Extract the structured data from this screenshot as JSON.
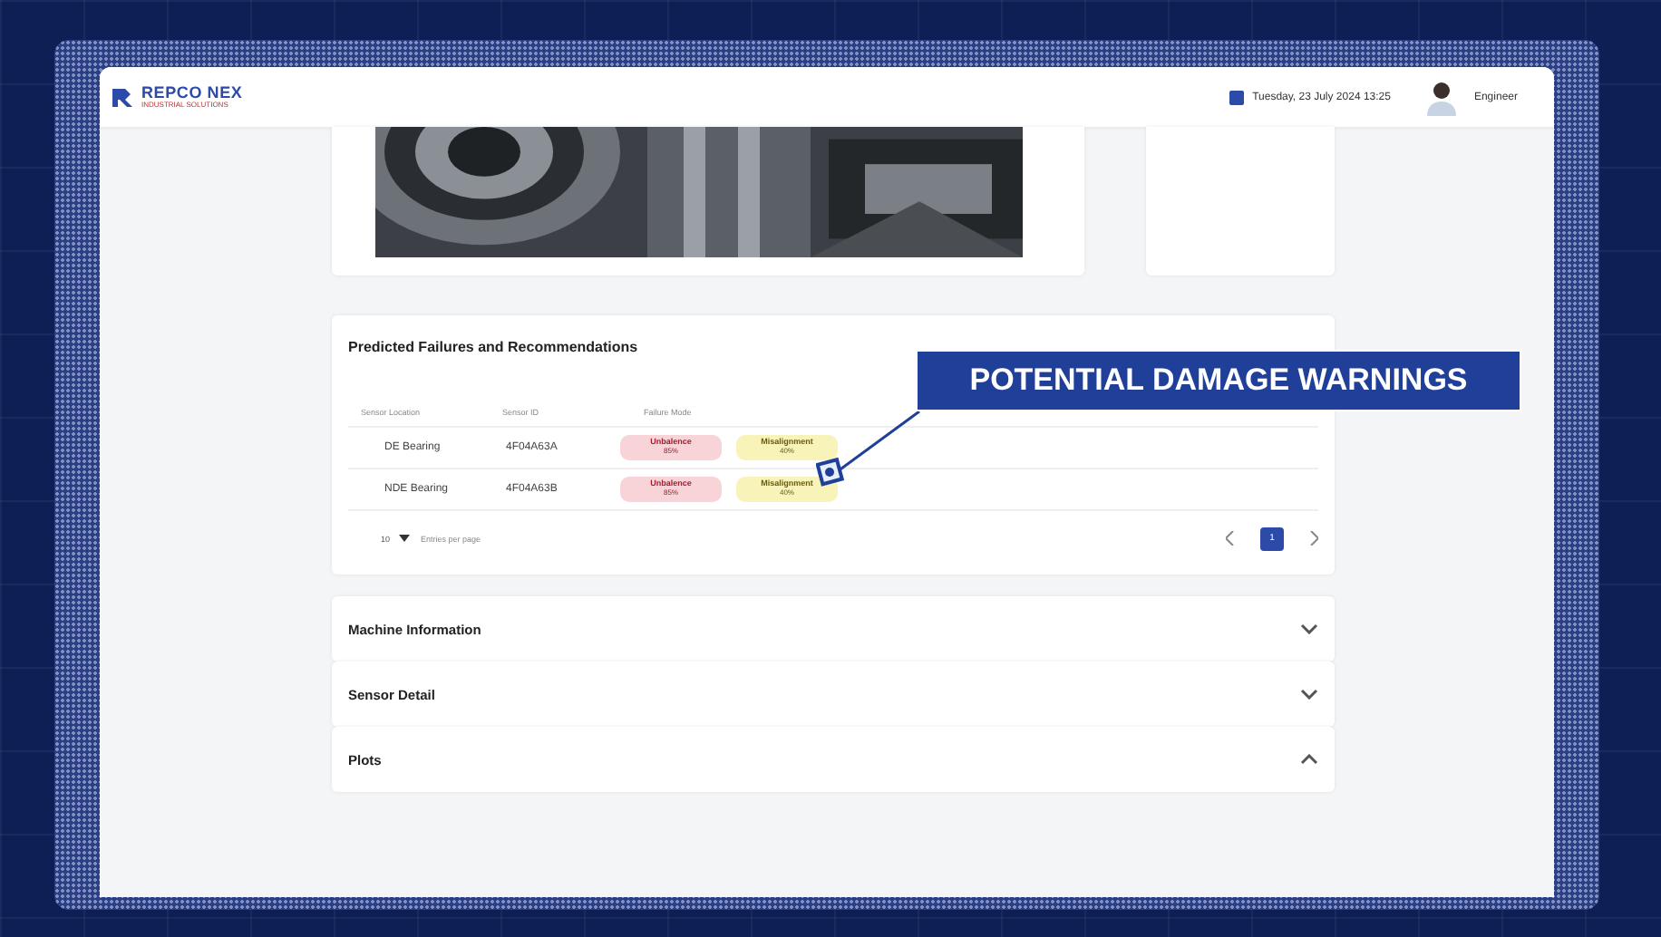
{
  "header": {
    "logo": "REPCO NEX",
    "logo_subtitle": "INDUSTRIAL SOLUTIONS",
    "datetime": "Tuesday, 23 July 2024 13:25",
    "user": "Engineer"
  },
  "failures": {
    "title": "Predicted Failures and Recommendations",
    "columns": [
      "Sensor Location",
      "Sensor ID",
      "Failure Mode"
    ],
    "rows": [
      {
        "location": "DE Bearing",
        "sensor_id": "4F04A63A",
        "modes": [
          {
            "name": "Unbalence",
            "percent": "85%",
            "kind": "severe"
          },
          {
            "name": "Misalignment",
            "percent": "40%",
            "kind": "moderate"
          }
        ]
      },
      {
        "location": "NDE Bearing",
        "sensor_id": "4F04A63B",
        "modes": [
          {
            "name": "Unbalence",
            "percent": "85%",
            "kind": "severe"
          },
          {
            "name": "Misalignment",
            "percent": "40%",
            "kind": "moderate"
          }
        ]
      }
    ],
    "page_size": "10",
    "page_size_label": "Entries per page",
    "pages": [
      {
        "label": "1",
        "selected": true
      }
    ]
  },
  "sections": [
    {
      "title": "Machine Information",
      "expanded": false
    },
    {
      "title": "Sensor Detail",
      "expanded": false
    },
    {
      "title": "Plots",
      "expanded": true
    }
  ],
  "callout": "POTENTIAL DAMAGE WARNINGS"
}
